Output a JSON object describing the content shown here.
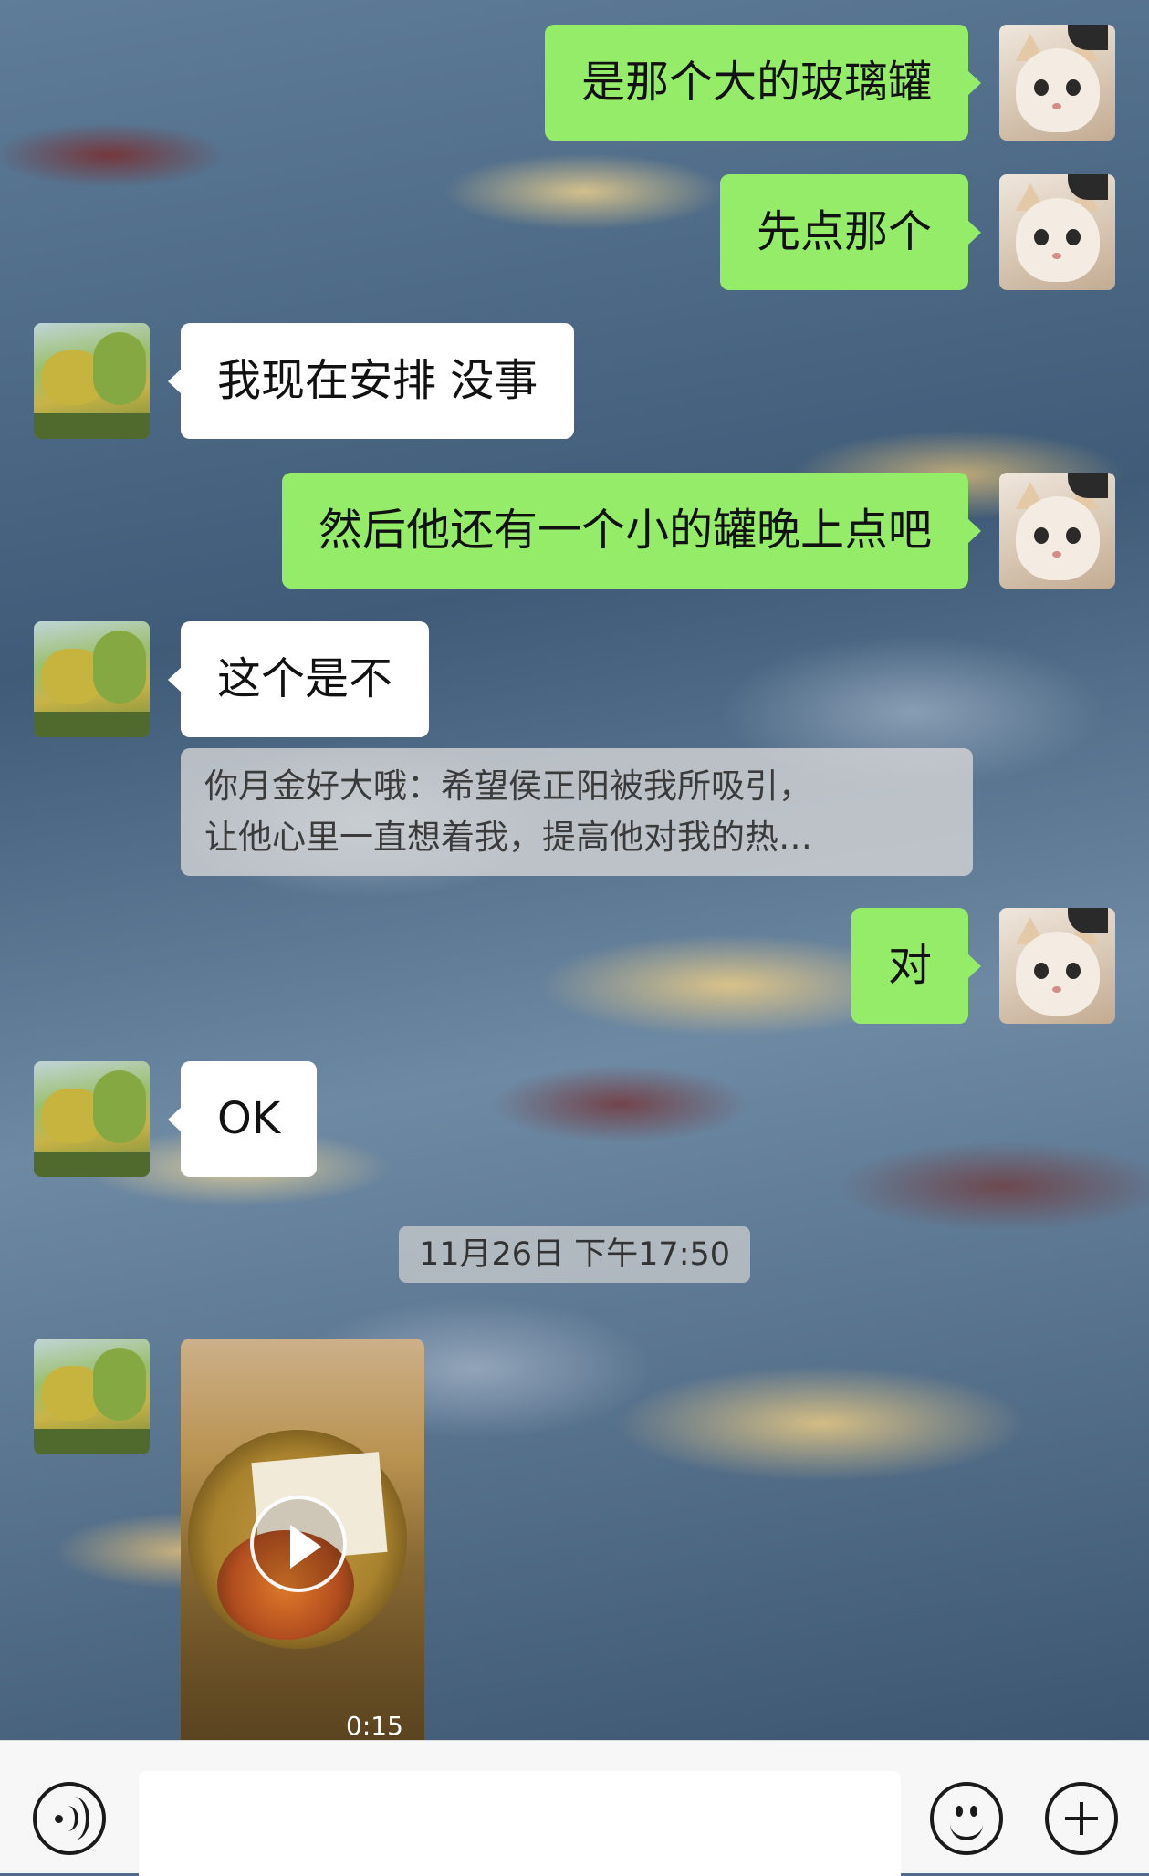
{
  "messages": [
    {
      "side": "right",
      "type": "text",
      "text": "是那个大的玻璃罐"
    },
    {
      "side": "right",
      "type": "text",
      "text": "先点那个"
    },
    {
      "side": "left",
      "type": "text",
      "text": "我现在安排 没事"
    },
    {
      "side": "right",
      "type": "text",
      "text": "然后他还有一个小的罐晚上点吧"
    },
    {
      "side": "left",
      "type": "text",
      "text": "这个是不"
    },
    {
      "side": "left",
      "type": "quote",
      "lines": [
        "你月金好大哦：希望侯正阳被我所吸引，",
        "让他心里一直想着我，提高他对我的热…"
      ]
    },
    {
      "side": "right",
      "type": "text",
      "text": "对"
    },
    {
      "side": "left",
      "type": "text",
      "text": "OK"
    },
    {
      "side": "left",
      "type": "video",
      "duration": "0:15"
    }
  ],
  "timestamp": "11月26日 下午17:50",
  "avatars": {
    "self": "cat-photo",
    "contact": "tree-painting"
  },
  "input_bar": {
    "voice_icon": "voice-icon",
    "text_value": "",
    "emoji_icon": "emoji-icon",
    "plus_icon": "plus-icon"
  },
  "colors": {
    "bubble_self": "#95ec69",
    "bubble_other": "#ffffff",
    "input_bar_bg": "#f7f7f7"
  }
}
